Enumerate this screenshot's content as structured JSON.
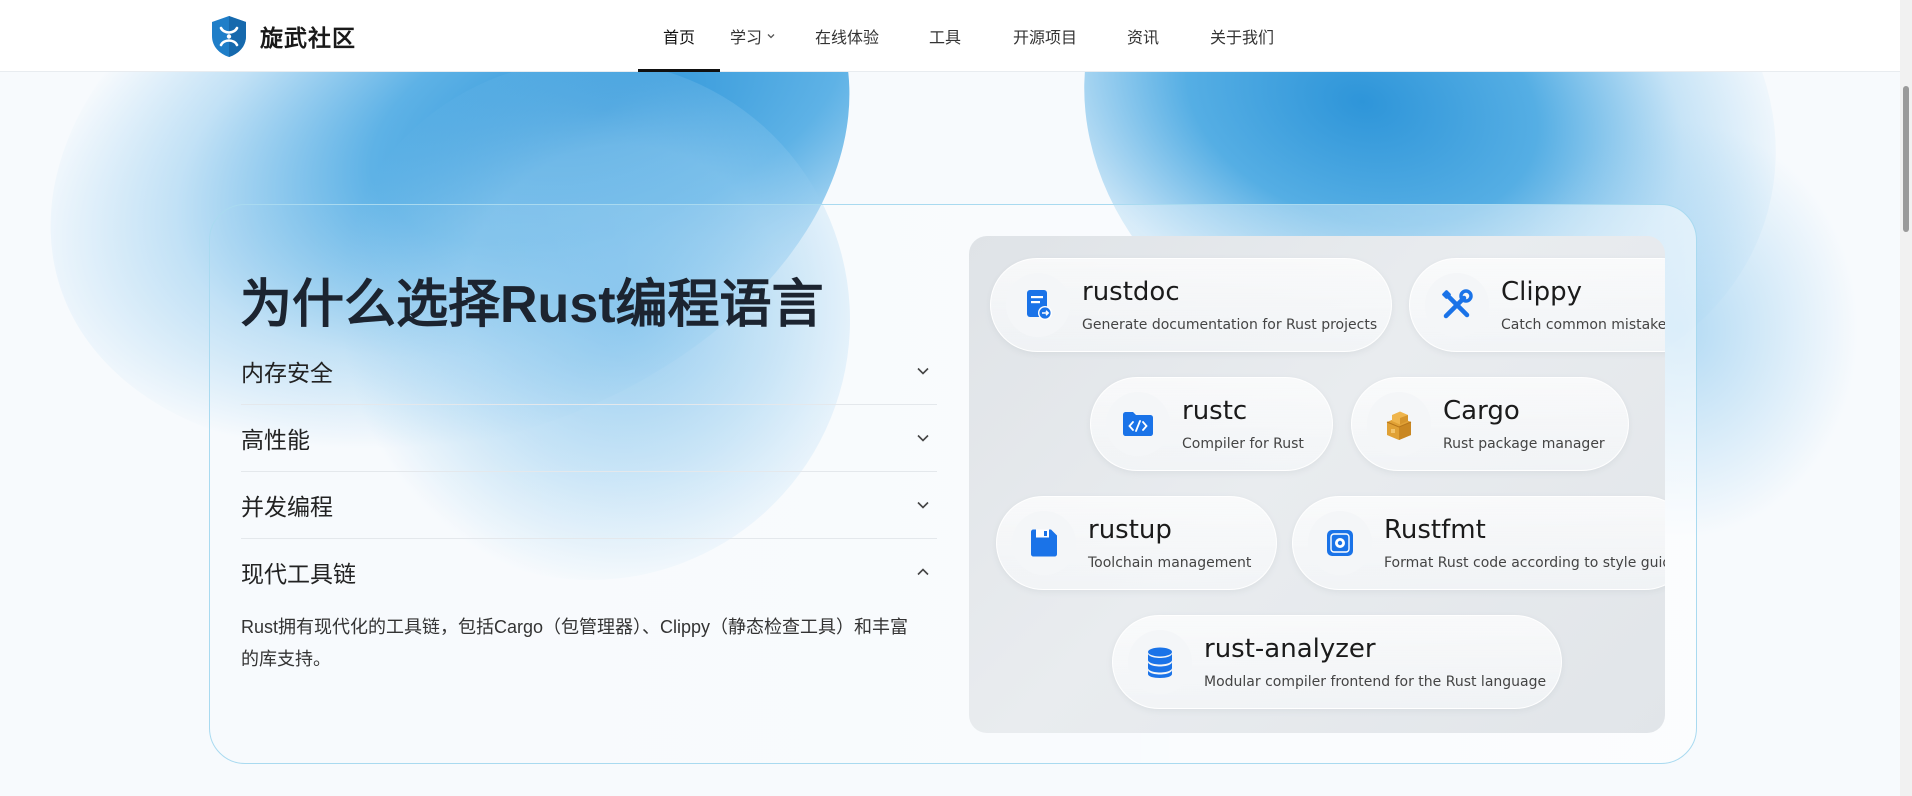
{
  "colors": {
    "accent_blue": "#2e95d9",
    "icon_blue": "#1a73e8",
    "card_border": "#a9daf0",
    "cargo_orange": "#e8a33a"
  },
  "header": {
    "logo_text": "旋武社区",
    "logo_icon": "shield-logo-icon",
    "nav": [
      {
        "label": "首页",
        "active": true
      },
      {
        "label": "学习",
        "has_dropdown": true
      },
      {
        "label": "在线体验"
      },
      {
        "label": "工具"
      },
      {
        "label": "开源项目"
      },
      {
        "label": "资讯"
      },
      {
        "label": "关于我们"
      }
    ]
  },
  "section": {
    "title": "为什么选择Rust编程语言",
    "accordion": [
      {
        "label": "内存安全",
        "expanded": false
      },
      {
        "label": "高性能",
        "expanded": false
      },
      {
        "label": "并发编程",
        "expanded": false
      },
      {
        "label": "现代工具链",
        "expanded": true,
        "body": "Rust拥有现代化的工具链，包括Cargo（包管理器）、Clippy（静态检查工具）和丰富的库支持。"
      }
    ],
    "tools": [
      {
        "name": "rustdoc",
        "desc": "Generate documentation for Rust projects",
        "icon": "document-icon"
      },
      {
        "name": "Clippy",
        "desc": "Catch common mistakes",
        "icon": "wrench-screwdriver-icon"
      },
      {
        "name": "rustc",
        "desc": "Compiler for Rust",
        "icon": "code-folder-icon"
      },
      {
        "name": "Cargo",
        "desc": "Rust package manager",
        "icon": "package-boxes-icon"
      },
      {
        "name": "rustup",
        "desc": "Toolchain management",
        "icon": "save-disk-icon"
      },
      {
        "name": "Rustfmt",
        "desc": "Format Rust code according to style guidel",
        "icon": "format-gear-icon"
      },
      {
        "name": "rust-analyzer",
        "desc": "Modular compiler frontend for the Rust language",
        "icon": "database-icon"
      }
    ]
  }
}
